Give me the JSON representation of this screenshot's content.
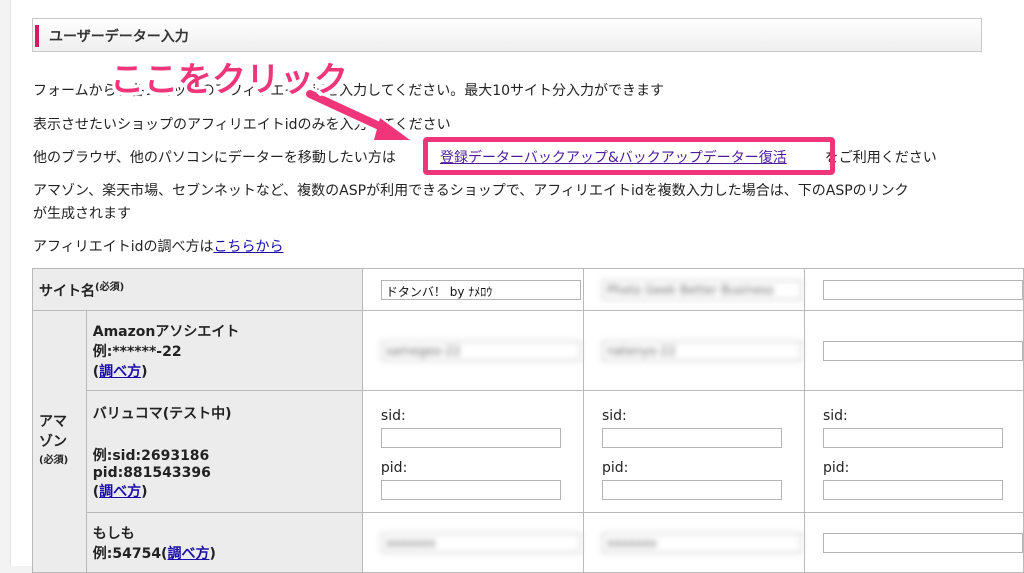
{
  "section": {
    "title": "ユーザーデーター入力"
  },
  "intro": {
    "line1": "フォームから、各ショップのアフィリエイトidを入力してください。最大10サイト分入力ができます",
    "line2": "表示させたいショップのアフィリエイトidのみを入力してください",
    "line3_pre": "他のブラウザ、他のパソコンにデーターを移動したい方は",
    "line3_link": "登録データーバックアップ&バックアップデーター復活",
    "line3_post": "をご利用ください",
    "line4": "アマゾン、楽天市場、セブンネットなど、複数のASPが利用できるショップで、アフィリエイトidを複数入力した場合は、下のASPのリンク",
    "line5": "が生成されます",
    "line6_pre": "アフィリエイトidの調べ方は",
    "line6_link": "こちらから"
  },
  "callout": {
    "text": "ここをクリック",
    "color": "#f0357a"
  },
  "table": {
    "site_name_label": "サイト名",
    "required": "(必須)",
    "site_values": [
      "ドタンバ！ by ﾅﾒﾛｳ",
      "Photo Geek Better Business",
      ""
    ],
    "group_amazon": "アマゾン",
    "amazon": {
      "title": "Amazonアソシエイト",
      "example": "例:******-22",
      "howto": "調べ方",
      "values": [
        "samegeo-22",
        "natenyo-22",
        ""
      ]
    },
    "valuecommerce": {
      "title": "バリュコマ(テスト中)",
      "example_sid": "例:sid:2693186",
      "example_pid": "pid:881543396",
      "howto": "調べ方",
      "sid_label": "sid:",
      "pid_label": "pid:"
    },
    "moshimo": {
      "title": "もしも",
      "example": "例:54754(",
      "howto": "調べ方",
      "example_close": ")",
      "values": [
        "xxxxxxx",
        "xxxxxxx",
        ""
      ]
    }
  }
}
